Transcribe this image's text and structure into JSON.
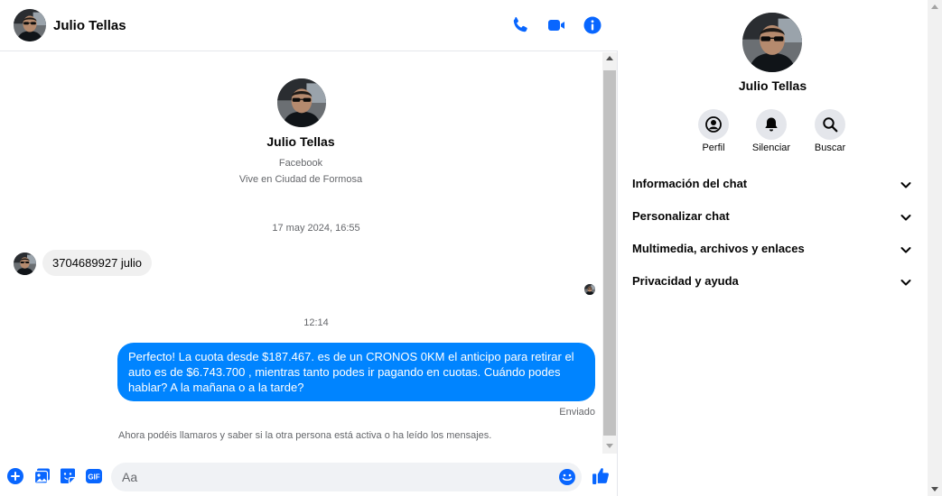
{
  "colors": {
    "accent": "#0084ff",
    "icon_blue": "#0866ff",
    "incoming_bubble": "#f0f0f0",
    "muted_text": "#65676b"
  },
  "header": {
    "contact_name": "Julio Tellas",
    "icons": [
      "phone-icon",
      "video-camera-icon",
      "info-icon"
    ]
  },
  "intro": {
    "name": "Julio Tellas",
    "platform": "Facebook",
    "location": "Vive en Ciudad de Formosa"
  },
  "messages": [
    {
      "type": "timestamp",
      "text": "17 may 2024, 16:55"
    },
    {
      "type": "incoming",
      "text": "3704689927 julio"
    },
    {
      "type": "timestamp",
      "text": "12:14"
    },
    {
      "type": "outgoing",
      "text": "Perfecto! La cuota desde $187.467. es de un CRONOS 0KM el anticipo para retirar el auto es de $6.743.700 , mientras tanto podes ir pagando en cuotas. Cuándo podes hablar? A la mañana o a la tarde?",
      "status": "Enviado"
    }
  ],
  "notice": "Ahora podéis llamaros y saber si la otra persona está activa o ha leído los mensajes.",
  "composer": {
    "placeholder": "Aa",
    "icons": [
      "plus-icon",
      "image-icon",
      "sticker-icon",
      "gif-icon",
      "emoji-icon",
      "like-icon"
    ]
  },
  "info_panel": {
    "name": "Julio Tellas",
    "actions": [
      {
        "label": "Perfil",
        "icon": "profile-icon"
      },
      {
        "label": "Silenciar",
        "icon": "bell-icon"
      },
      {
        "label": "Buscar",
        "icon": "search-icon"
      }
    ],
    "sections": [
      "Información del chat",
      "Personalizar chat",
      "Multimedia, archivos y enlaces",
      "Privacidad y ayuda"
    ]
  }
}
